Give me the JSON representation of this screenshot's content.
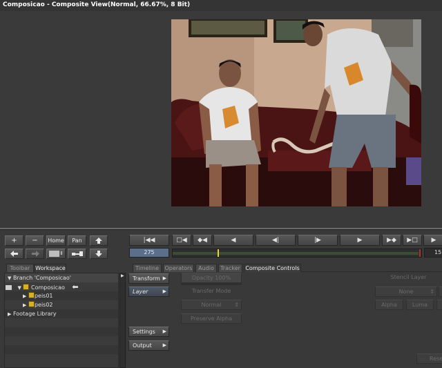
{
  "window": {
    "title": "Composicao - Composite View(Normal, 66.67%, 8 Bit)"
  },
  "toolbar": {
    "plus_label": "+",
    "minus_label": "−",
    "home_label": "Home",
    "pan_label": "Pan",
    "back_icon": "arrow-left-icon",
    "forward_icon": "arrow-right-icon",
    "export_icon": "arrow-up-icon",
    "import_icon": "arrow-down-icon"
  },
  "transport": {
    "buttons": [
      {
        "label": "|◀◀",
        "icon": "go-to-start-icon"
      },
      {
        "label": "□◀",
        "icon": "mark-in-icon"
      },
      {
        "label": "◆◀",
        "icon": "prev-key-icon"
      },
      {
        "label": "◀",
        "icon": "play-reverse-icon"
      },
      {
        "label": "◀|",
        "icon": "step-back-icon"
      },
      {
        "label": "|▶",
        "icon": "step-forward-icon"
      },
      {
        "label": "▶",
        "icon": "play-icon"
      },
      {
        "label": "▶◆",
        "icon": "next-key-icon"
      },
      {
        "label": "▶□",
        "icon": "mark-out-icon"
      },
      {
        "label": "▶",
        "icon": "go-to-end-icon"
      }
    ],
    "current_frame": "275",
    "end_frame": "15",
    "playhead_fraction": 0.18
  },
  "left_tabs": [
    {
      "label": "Toolbar"
    },
    {
      "label": "Workspace"
    }
  ],
  "workspace": {
    "branch_label": "Branch 'Composicao'",
    "composite_label": "Composicao",
    "layers": [
      {
        "label": "peis01"
      },
      {
        "label": "peis02"
      }
    ],
    "footage_label": "Footage Library"
  },
  "right_tabs": [
    {
      "label": "Timeline"
    },
    {
      "label": "Operators"
    },
    {
      "label": "Audio"
    },
    {
      "label": "Tracker"
    },
    {
      "label": "Composite Controls"
    }
  ],
  "side_buttons": {
    "transform": "Transform",
    "layer": "Layer",
    "settings": "Settings",
    "output": "Output"
  },
  "layer_controls": {
    "opacity": "Opacity 100%",
    "transfer_mode_label": "Transfer Mode",
    "transfer_mode_value": "Normal",
    "preserve_alpha": "Preserve Alpha"
  },
  "stencil": {
    "stencil_layer": "Stencil Layer",
    "none_value": "None",
    "alpha": "Alpha",
    "luma": "Luma"
  },
  "corner_button": "Rese"
}
